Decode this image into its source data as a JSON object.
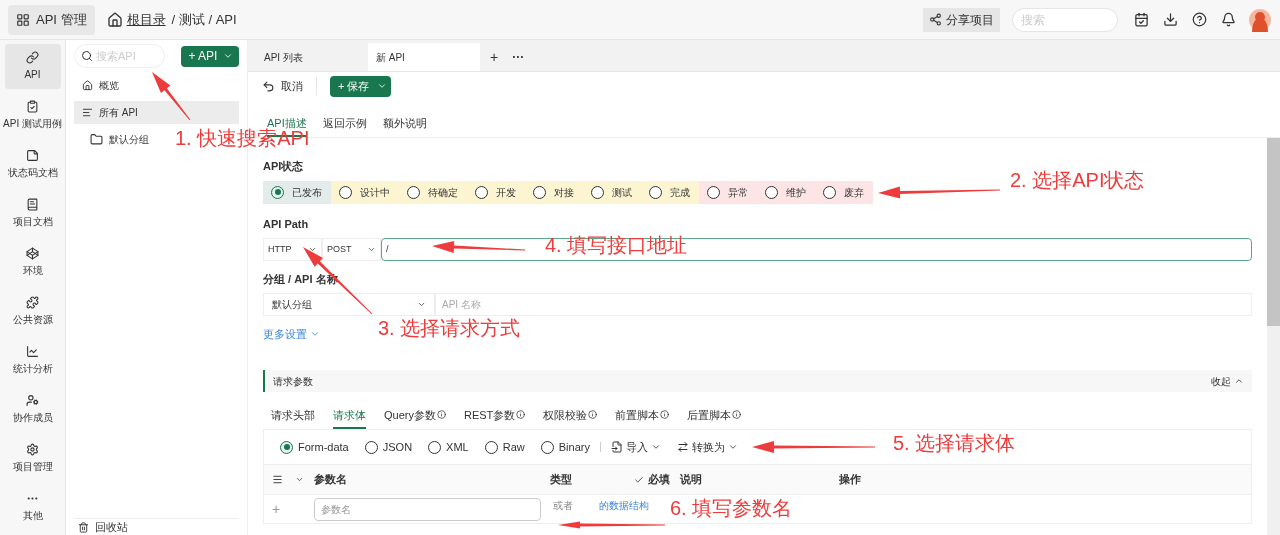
{
  "header": {
    "app_button": "API 管理",
    "breadcrumb": [
      "根目录",
      "/ 测试 / API"
    ],
    "share_button": "分享项目",
    "search": {
      "placeholder": "搜索"
    }
  },
  "nav": [
    {
      "label": "API",
      "selected": true
    },
    {
      "label": "API 测试用例",
      "selected": false
    },
    {
      "label": "状态码文档",
      "selected": false
    },
    {
      "label": "项目文档",
      "selected": false
    },
    {
      "label": "环境",
      "selected": false
    },
    {
      "label": "公共资源",
      "selected": false
    },
    {
      "label": "统计分析",
      "selected": false
    },
    {
      "label": "协作成员",
      "selected": false
    },
    {
      "label": "项目管理",
      "selected": false
    },
    {
      "label": "其他",
      "selected": false
    }
  ],
  "tree": {
    "search": {
      "placeholder": "搜索API"
    },
    "add_button": "+ API",
    "items": [
      {
        "label": "概览",
        "selected": false
      },
      {
        "label": "所有 API",
        "selected": true,
        "children": [
          {
            "label": "默认分组",
            "selected": false
          }
        ]
      }
    ],
    "trash": "回收站"
  },
  "doc_tabs": [
    {
      "label": "API 列表",
      "selected": false
    },
    {
      "label": "新 API",
      "selected": true
    }
  ],
  "doc_tab_actions": [
    "+",
    "···"
  ],
  "toolbar": {
    "cancel": "取消",
    "save": "+ 保存"
  },
  "sub_tabs": [
    {
      "label": "API描述",
      "selected": true
    },
    {
      "label": "返回示例",
      "selected": false
    },
    {
      "label": "额外说明",
      "selected": false
    }
  ],
  "form": {
    "status_label": "API状态",
    "statuses": [
      {
        "label": "已发布",
        "selected": true,
        "color": "#e3ecea"
      },
      {
        "label": "设计中",
        "selected": false,
        "color": "#fdf5d2"
      },
      {
        "label": "待确定",
        "selected": false,
        "color": "#fdf5d2"
      },
      {
        "label": "开发",
        "selected": false,
        "color": "#fdf5d2"
      },
      {
        "label": "对接",
        "selected": false,
        "color": "#fdf5d2"
      },
      {
        "label": "测试",
        "selected": false,
        "color": "#fdf5d2"
      },
      {
        "label": "完成",
        "selected": false,
        "color": "#fdf5d2"
      },
      {
        "label": "异常",
        "selected": false,
        "color": "#fde5e6"
      },
      {
        "label": "维护",
        "selected": false,
        "color": "#fde5e6"
      },
      {
        "label": "废弃",
        "selected": false,
        "color": "#fde5e6"
      }
    ],
    "path_label": "API Path",
    "protocol": "HTTP",
    "method": "POST",
    "path": "/",
    "group_label": "分组 / API 名称",
    "group": "默认分组",
    "name_placeholder": "API 名称",
    "more_settings": "更多设置"
  },
  "params": {
    "title": "请求参数",
    "collapse": "收起",
    "tabs": [
      {
        "label": "请求头部",
        "info": false,
        "selected": false
      },
      {
        "label": "请求体",
        "info": false,
        "selected": true
      },
      {
        "label": "Query参数",
        "info": true,
        "selected": false
      },
      {
        "label": "REST参数",
        "info": true,
        "selected": false
      },
      {
        "label": "权限校验",
        "info": true,
        "selected": false
      },
      {
        "label": "前置脚本",
        "info": true,
        "selected": false
      },
      {
        "label": "后置脚本",
        "info": true,
        "selected": false
      }
    ],
    "body_types": [
      {
        "label": "Form-data",
        "selected": true
      },
      {
        "label": "JSON",
        "selected": false
      },
      {
        "label": "XML",
        "selected": false
      },
      {
        "label": "Raw",
        "selected": false
      },
      {
        "label": "Binary",
        "selected": false
      }
    ],
    "import": "导入",
    "convert": "转换为",
    "columns": [
      "参数名",
      "类型",
      "必填",
      "说明",
      "操作"
    ],
    "row": {
      "add": "+",
      "name_placeholder": "参数名",
      "type_text": "或者",
      "type_link": "的数据结构"
    }
  },
  "annotations": [
    {
      "text": "1. 快速搜索API"
    },
    {
      "text": "2. 选择API状态"
    },
    {
      "text": "3. 选择请求方式"
    },
    {
      "text": "4. 填写接口地址"
    },
    {
      "text": "5. 选择请求体"
    },
    {
      "text": "6. 填写参数名"
    }
  ]
}
